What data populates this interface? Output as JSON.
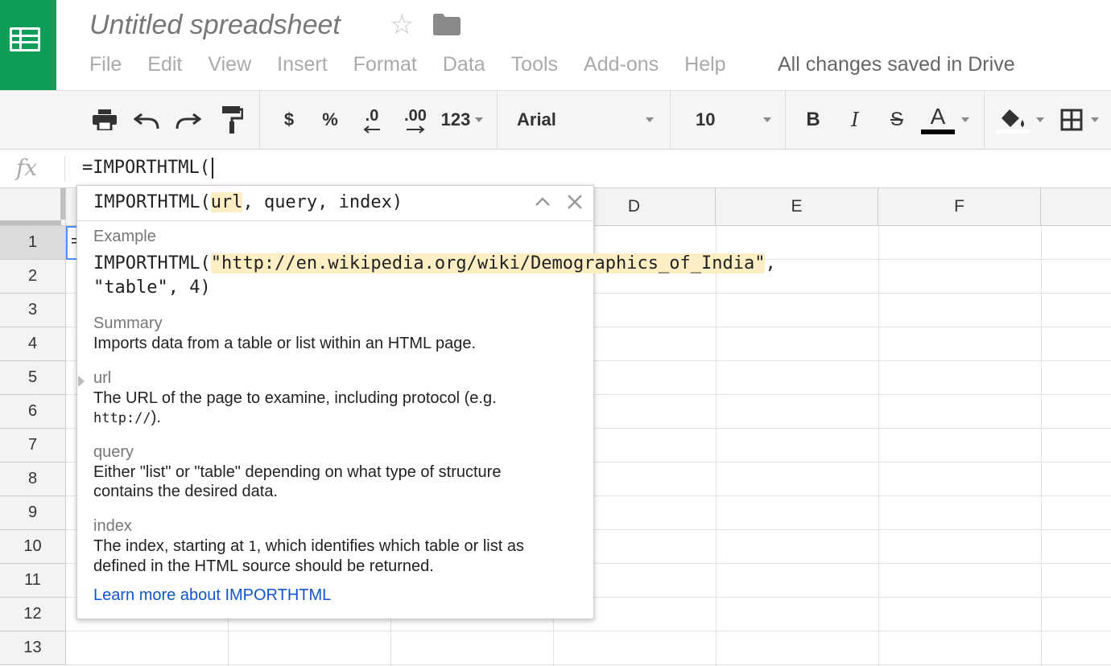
{
  "doc": {
    "title": "Untitled spreadsheet",
    "status": "All changes saved in Drive"
  },
  "menu": [
    "File",
    "Edit",
    "View",
    "Insert",
    "Format",
    "Data",
    "Tools",
    "Add-ons",
    "Help"
  ],
  "toolbar": {
    "currency": "$",
    "percent": "%",
    "decrease_decimal": ".0",
    "increase_decimal": ".00",
    "more_formats": "123",
    "font_family": "Arial",
    "font_size": "10",
    "bold": "B",
    "italic": "I",
    "strike": "S",
    "text_color_letter": "A",
    "text_color": "#000000",
    "icons": [
      "print-icon",
      "undo-icon",
      "redo-icon",
      "paint-format-icon",
      "fill-color-icon",
      "borders-icon"
    ]
  },
  "formula_bar": {
    "fx": "fx",
    "value": "=IMPORTHTML("
  },
  "grid": {
    "columns": [
      "D",
      "E",
      "F"
    ],
    "rows": [
      "1",
      "2",
      "3",
      "4",
      "5",
      "6",
      "7",
      "8",
      "9",
      "10",
      "11",
      "12",
      "13"
    ],
    "active_cell_text": "="
  },
  "help": {
    "fn": "IMPORTHTML(",
    "arg1": "url",
    "rest": ", query, index)",
    "example_label": "Example",
    "example_fn": "IMPORTHTML(",
    "example_url": "\"http://en.wikipedia.org/wiki/Demographics_of_India\"",
    "example_rest": ", \"table\", 4)",
    "summary_label": "Summary",
    "summary_text": "Imports data from a table or list within an HTML page.",
    "url_label": "url",
    "url_text": "The URL of the page to examine, including protocol (e.g.",
    "url_code": "http://",
    "url_tail": ").",
    "query_label": "query",
    "query_text": "Either \"list\" or \"table\" depending on what type of structure contains the desired data.",
    "index_label": "index",
    "index_pre": "The index, starting at ",
    "index_code": "1",
    "index_post": ", which identifies which table or list as defined in the HTML source should be returned.",
    "learn_more": "Learn more about IMPORTHTML"
  },
  "colors": {
    "brand_green": "#0f9d58",
    "link_blue": "#1155cc",
    "highlight": "#fdefc3",
    "selection_blue": "#4d90fe"
  }
}
